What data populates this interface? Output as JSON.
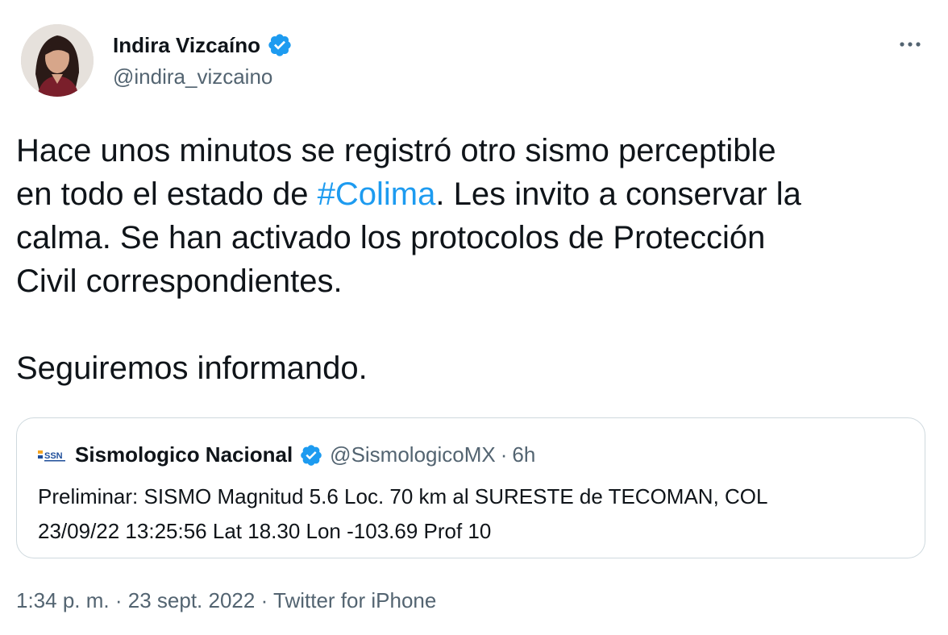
{
  "author": {
    "name": "Indira Vizcaíno",
    "handle": "@indira_vizcaino",
    "verified": true
  },
  "tweet": {
    "text_before": "Hace unos minutos se registró otro sismo perceptible\nen todo el estado de ",
    "hashtag": "#Colima",
    "text_after": ". Les invito a conservar la\ncalma. Se han activado los protocolos de Protección\nCivil correspondientes.\n\nSeguiremos informando."
  },
  "quoted_tweet": {
    "logo_text": "SSN",
    "name": "Sismologico Nacional",
    "handle": "@SismologicoMX",
    "separator": "·",
    "time": "6h",
    "text": "Preliminar: SISMO Magnitud 5.6 Loc. 70 km al SURESTE de TECOMAN, COL\n23/09/22 13:25:56 Lat 18.30 Lon -103.69 Prof 10"
  },
  "footer": {
    "time": "1:34 p. m.",
    "sep1": "·",
    "date": "23 sept. 2022",
    "sep2": "·",
    "source": "Twitter for iPhone"
  },
  "icons": {
    "verified": "verified-badge-icon",
    "more": "more-options-icon"
  },
  "colors": {
    "accent": "#1d9bf0",
    "text": "#0f1419",
    "secondary": "#536471",
    "border": "#cfd9de"
  }
}
